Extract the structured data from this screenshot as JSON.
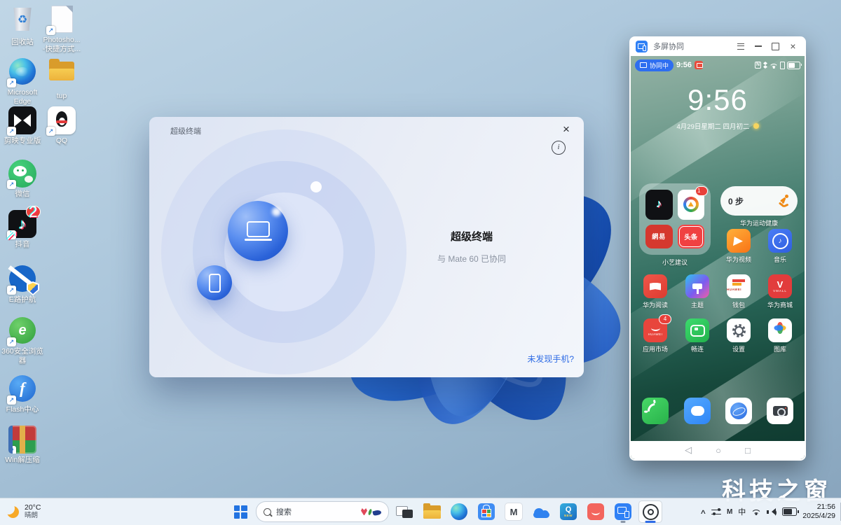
{
  "glyphs": {
    "note": "♪",
    "recycle": "♻",
    "back": "◁",
    "home": "○",
    "recents": "□",
    "chevron": "∧",
    "close": "×",
    "info": "i",
    "e360": "e",
    "flash": "f",
    "play": "▶",
    "arrow": "↗"
  },
  "desktop": {
    "watermark": "科技之窗",
    "icons": [
      {
        "label": "回收站"
      },
      {
        "label": "Photosho...",
        "label2": "-快捷方式..."
      },
      {
        "label": "Microsoft",
        "label2": "Edge"
      },
      {
        "label": "tup"
      },
      {
        "label": "剪映专业版"
      },
      {
        "label": "QQ"
      },
      {
        "label": "微信"
      },
      {
        "label": "抖音",
        "badge": "2"
      },
      {
        "label": "E路护航"
      },
      {
        "label": "360安全浏览",
        "label2": "器"
      },
      {
        "label": "Flash中心"
      },
      {
        "label": "Win解压缩"
      }
    ]
  },
  "dialog": {
    "title": "超级终端",
    "heading": "超级终端",
    "subtitle": "与 Mate 60 已协同",
    "link": "未发现手机?"
  },
  "phone": {
    "title": "多屏协同",
    "status": {
      "pill": "协同中",
      "time": "9:56",
      "nfc": "N"
    },
    "clock": {
      "time": "9:56",
      "date": "4月29日星期二  四月初二"
    },
    "folder": {
      "label": "小艺建议",
      "badge": "1",
      "netease": "網易",
      "toutiao": "头条"
    },
    "health": {
      "steps": "0 步",
      "label": "华为运动健康"
    },
    "apps": [
      {
        "label": "华为视频"
      },
      {
        "label": "音乐"
      },
      {
        "label": "华为阅读"
      },
      {
        "label": "主题"
      },
      {
        "label": "钱包",
        "brand": "HUAWEI"
      },
      {
        "label": "华为商城",
        "letter": "V",
        "brand": "VMALL"
      },
      {
        "label": "应用市场",
        "brand": "HUAWEI",
        "badge": "4"
      },
      {
        "label": "畅连"
      },
      {
        "label": "设置"
      },
      {
        "label": "图库"
      }
    ]
  },
  "taskbar": {
    "weather": {
      "temp": "20°C",
      "cond": "晴朗"
    },
    "search_placeholder": "搜索",
    "app_m": "M",
    "app_q": "Q",
    "app_q_tag": "NEW",
    "tray_m": "M",
    "input_method": "中",
    "clock": {
      "time": "21:56",
      "date": "2025/4/29"
    }
  }
}
